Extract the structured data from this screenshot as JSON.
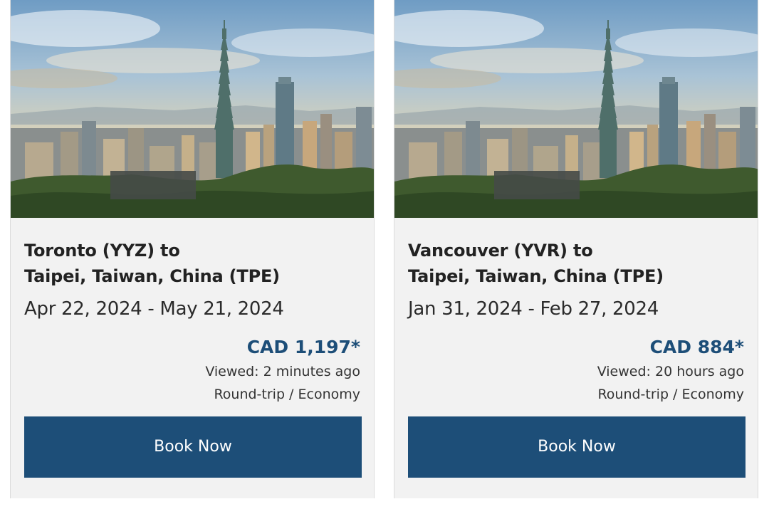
{
  "cards": [
    {
      "route_from": "Toronto (YYZ) to",
      "route_to": "Taipei, Taiwan, China (TPE)",
      "dates": "Apr 22, 2024 - May 21, 2024",
      "price": "CAD 1,197*",
      "viewed": "Viewed: 2 minutes ago",
      "trip_type": "Round-trip / Economy",
      "button_label": "Book Now"
    },
    {
      "route_from": "Vancouver (YVR) to",
      "route_to": "Taipei, Taiwan, China (TPE)",
      "dates": "Jan 31, 2024 - Feb 27, 2024",
      "price": "CAD 884*",
      "viewed": "Viewed: 20 hours ago",
      "trip_type": "Round-trip / Economy",
      "button_label": "Book Now"
    }
  ],
  "colors": {
    "brand_blue": "#1d4e78",
    "card_background": "#f2f2f2"
  }
}
